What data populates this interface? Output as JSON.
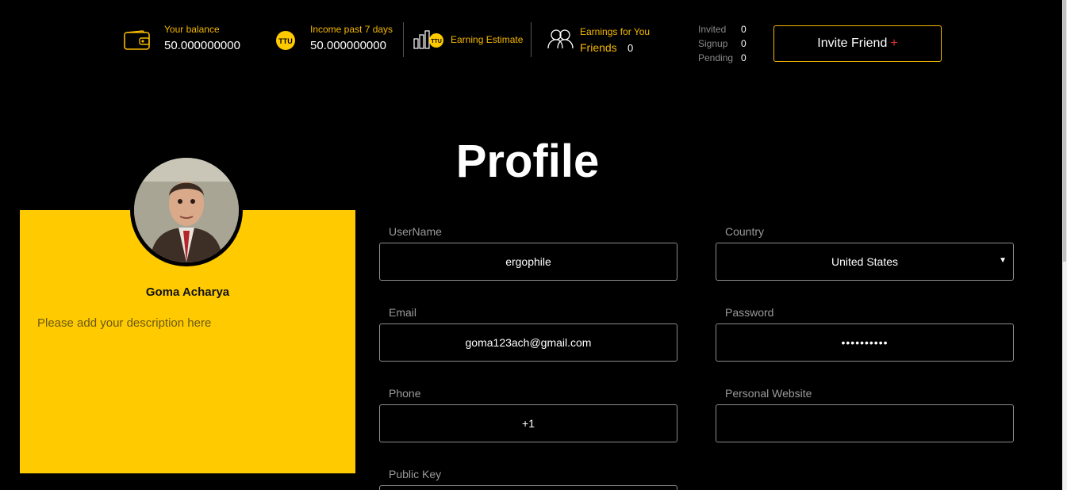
{
  "colors": {
    "accent": "#ffca00",
    "background": "#000000",
    "plus": "#e53030"
  },
  "header": {
    "balance": {
      "label": "Your balance",
      "value": "50.000000000",
      "icon": "wallet-icon"
    },
    "income": {
      "label": "Income past 7 days",
      "value": "50.000000000",
      "icon": "ttu-coin-icon",
      "coin_text": "TTU"
    },
    "estimate": {
      "label": "Earning Estimate",
      "icon": "bar-chart-coin-icon",
      "coin_text": "TTU"
    },
    "earnings": {
      "label": "Earnings for You",
      "friends_label": "Friends",
      "friends_value": "0",
      "icon": "friends-icon"
    },
    "stats": [
      {
        "label": "Invited",
        "value": "0"
      },
      {
        "label": "Signup",
        "value": "0"
      },
      {
        "label": "Pending",
        "value": "0"
      }
    ],
    "invite_button": {
      "label": "Invite Friend",
      "plus": "+"
    }
  },
  "page_title": "Profile",
  "profile_card": {
    "name": "Goma Acharya",
    "description_placeholder": "Please add your description here"
  },
  "form": {
    "username": {
      "label": "UserName",
      "value": "ergophile"
    },
    "country": {
      "label": "Country",
      "value": "United States"
    },
    "email": {
      "label": "Email",
      "value": "goma123ach@gmail.com"
    },
    "password": {
      "label": "Password",
      "value": "••••••••••"
    },
    "phone": {
      "label": "Phone",
      "value": "+1"
    },
    "website": {
      "label": "Personal Website",
      "value": ""
    },
    "public_key": {
      "label": "Public Key",
      "value": ""
    }
  }
}
